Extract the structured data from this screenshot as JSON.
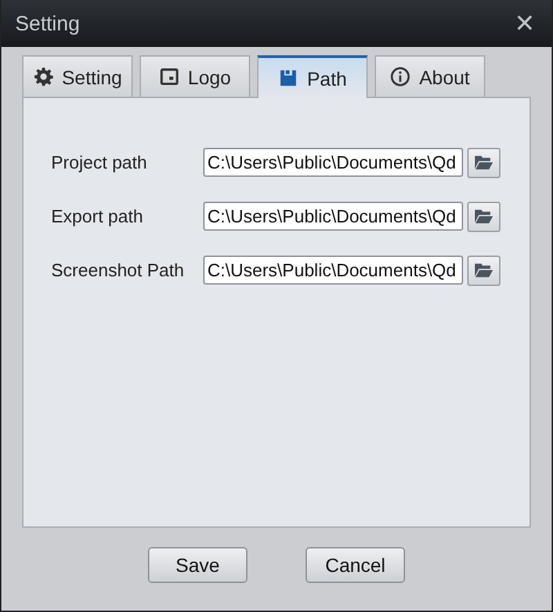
{
  "window": {
    "title": "Setting",
    "close": "✕"
  },
  "tabs": [
    {
      "label": "Setting",
      "kind": "gear",
      "selected": false
    },
    {
      "label": "Logo",
      "kind": "logo",
      "selected": false
    },
    {
      "label": "Path",
      "kind": "disk",
      "selected": true
    },
    {
      "label": "About",
      "kind": "info",
      "selected": false
    }
  ],
  "paths": [
    {
      "label": "Project path",
      "value": "C:\\Users\\Public\\Documents\\Qd"
    },
    {
      "label": "Export path",
      "value": "C:\\Users\\Public\\Documents\\Qd"
    },
    {
      "label": "Screenshot Path",
      "value": "C:\\Users\\Public\\Documents\\Qd"
    }
  ],
  "buttons": [
    "Save",
    "Cancel"
  ]
}
